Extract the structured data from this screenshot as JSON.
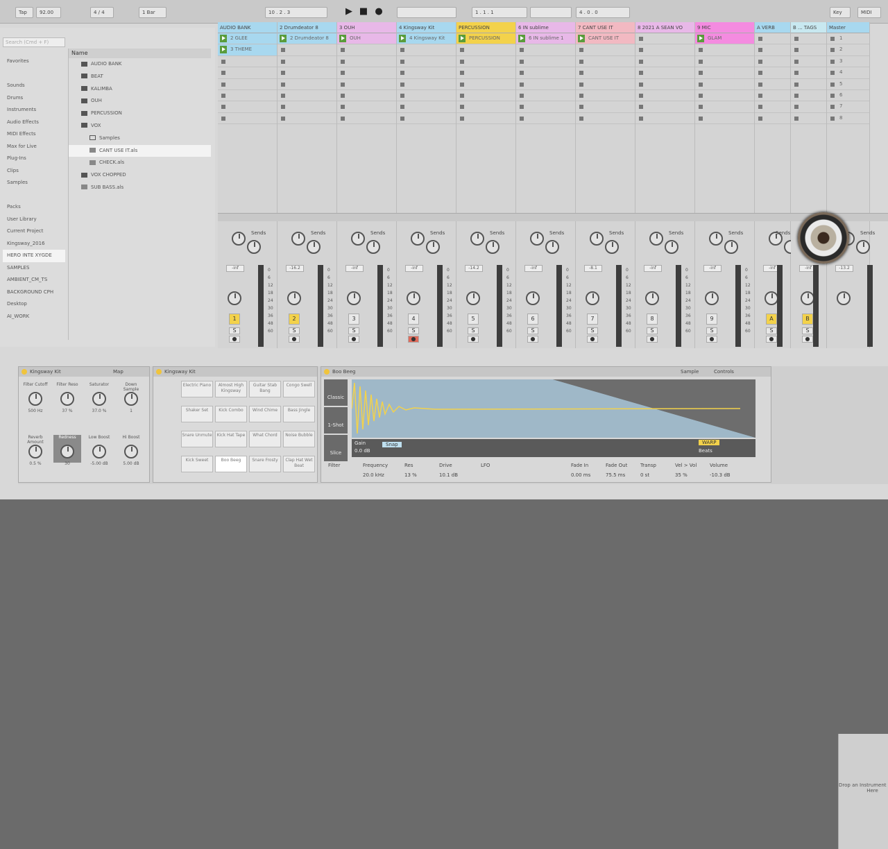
{
  "topbar": {
    "tap": "Tap",
    "bpm": "92.00",
    "sig": "4 / 4",
    "bar": "1 Bar",
    "position": "10 . 2 . 3",
    "punch": "1 . 1 . 1",
    "right_pos": "4 . 0 . 0",
    "key": "Key",
    "midi": "MIDI"
  },
  "browser": {
    "search_placeholder": "Search (Cmd + F)",
    "places": [
      "Favorites",
      "",
      "Sounds",
      "Drums",
      "Instruments",
      "Audio Effects",
      "MIDI Effects",
      "Max for Live",
      "Plug-Ins",
      "Clips",
      "Samples",
      "",
      "Packs",
      "User Library",
      "Current Project",
      "Kingsway_2016",
      "HERO INTE XYGDE",
      "SAMPLES",
      "AMBIENT_CM_TS",
      "BACKGROUND CPH",
      "Desktop",
      "AI_WORK"
    ],
    "name_header": "Name",
    "files": [
      "AUDIO BANK",
      "BEAT",
      "KALIMBA",
      "OUH",
      "PERCUSSION",
      "VOX",
      "Samples",
      "CANT USE IT.als",
      "CHECK.als",
      "VOX CHOPPED",
      "SUB BASS.als"
    ]
  },
  "tracks": [
    {
      "name": "AUDIO BANK",
      "color": "#a8d8ef",
      "clips": [
        "2 GLEE",
        "3 THEME"
      ],
      "num": "1",
      "vol": "-inf"
    },
    {
      "name": "2 Drumdeator 8",
      "color": "#a8d8ef",
      "clips": [
        "2 Drumdeator 8"
      ],
      "num": "2",
      "vol": "-16.2"
    },
    {
      "name": "3 OUH",
      "color": "#e8b8e8",
      "clips": [
        "OUH"
      ],
      "num": "3",
      "vol": "-inf"
    },
    {
      "name": "4 Kingsway Kit",
      "color": "#a8d8ef",
      "clips": [
        "4 Kingsway Kit"
      ],
      "num": "4",
      "vol": "-inf"
    },
    {
      "name": "PERCUSSION",
      "color": "#f3d24b",
      "clips": [
        "PERCUSSION"
      ],
      "num": "5",
      "vol": "-14.2"
    },
    {
      "name": "6 IN sublime",
      "color": "#e8b8e8",
      "clips": [
        "6 IN sublime 1"
      ],
      "num": "6",
      "vol": "-inf"
    },
    {
      "name": "7 CANT USE IT",
      "color": "#f2b9c2",
      "clips": [
        "CANT USE IT"
      ],
      "num": "7",
      "vol": "-8.1"
    },
    {
      "name": "8 2021 A SEAN VO",
      "color": "#e8b8e8",
      "clips": [],
      "num": "8",
      "vol": "-inf"
    },
    {
      "name": "9 MIC",
      "color": "#f48be0",
      "clips": [
        "GLAM"
      ],
      "num": "9",
      "vol": "-inf"
    },
    {
      "name": "A VERB",
      "color": "#a8d8ef",
      "clips": [],
      "num": "A",
      "vol": "-inf"
    },
    {
      "name": "B ... TAGS",
      "color": "#c8e8f0",
      "clips": [],
      "num": "B",
      "vol": "-inf"
    },
    {
      "name": "Master",
      "color": "#a8d8ef",
      "clips": [
        "1",
        "2",
        "3",
        "4",
        "5",
        "6",
        "7",
        "8"
      ],
      "num": "",
      "vol": "-13.2"
    }
  ],
  "mixer": {
    "sends_label": "Sends",
    "scale": [
      "0",
      "6",
      "12",
      "18",
      "24",
      "30",
      "36",
      "48",
      "60"
    ]
  },
  "drum_rack": {
    "title": "Kingsway Kit",
    "map": "Map",
    "macros": [
      "Filter Cutoff",
      "Filter Reso",
      "Saturator",
      "Down Sample",
      "Reverb Amount",
      "Redness",
      "Low Boost",
      "Hi Boost"
    ],
    "macro_values": [
      "500 Hz",
      "37 %",
      "37.0 %",
      "1",
      "0.5 %",
      "30",
      "-5.00 dB",
      "5.00 dB"
    ]
  },
  "pads": {
    "title": "Kingsway Kit",
    "labels": [
      "Electric Piano",
      "Almost High Kingsway",
      "Guitar Stab Bang",
      "Congo Swell",
      "Shaker Set",
      "Kick Combo",
      "Wind Chime",
      "Bass Jingle",
      "Snare Unmute",
      "Kick Hat Tape",
      "What Chord",
      "Noise Bubble",
      "Kick Sweet",
      "Boo Beeg",
      "Snare Frosty",
      "Clap Hat Wet Beat"
    ]
  },
  "sampler": {
    "title": "Boo Beeg",
    "tab_sample": "Sample",
    "tab_controls": "Controls",
    "modes": [
      "Classic",
      "1-Shot",
      "Slice"
    ],
    "gain_label": "Gain",
    "gain": "0.0 dB",
    "snap": "Snap",
    "warp": "WARP",
    "beats": "Beats",
    "params": [
      "Filter",
      "Frequency",
      "Res",
      "Drive",
      "LFO",
      "Fade In",
      "Fade Out",
      "Transp",
      "Vel > Vol",
      "Volume"
    ],
    "param_values": [
      "",
      "20.0 kHz",
      "13 %",
      "10.1 dB",
      "",
      "0.00 ms",
      "75.5 ms",
      "0 st",
      "35 %",
      "-10.3 dB"
    ]
  },
  "right_panel": {
    "hint": "Drop an Instrument Sample Here"
  }
}
